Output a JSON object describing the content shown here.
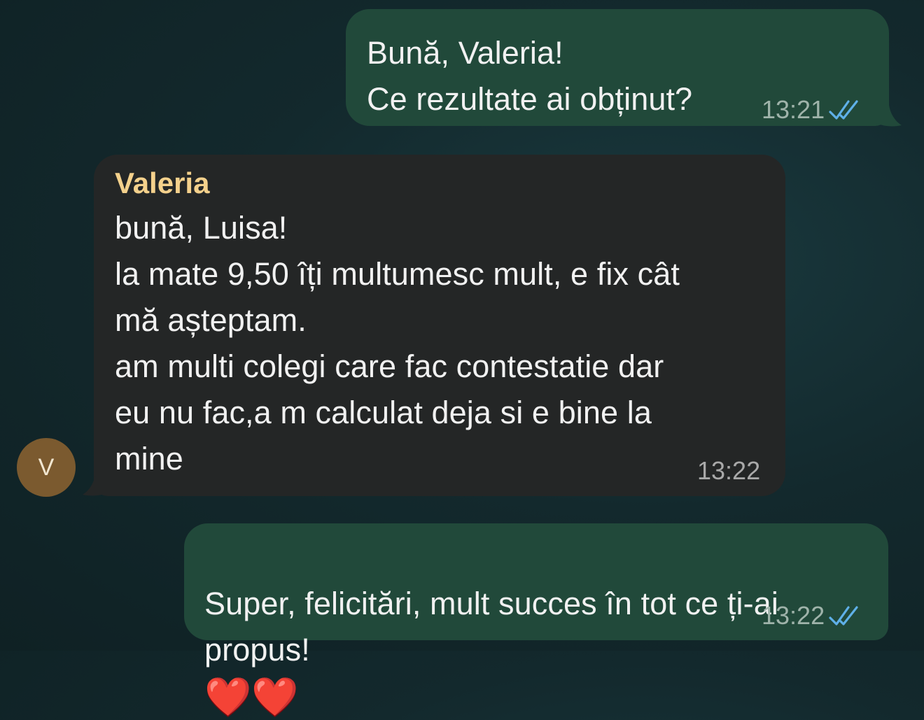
{
  "messages": [
    {
      "direction": "out",
      "text": "Bună, Valeria!\nCe rezultate ai obținut?",
      "time": "13:21",
      "status_icon": "double-check-read-icon"
    },
    {
      "direction": "in",
      "sender": "Valeria",
      "text": "bună, Luisa!\nla mate 9,50 îți multumesc mult, e fix cât\nmă așteptam.\nam multi colegi care fac contestatie dar\neu nu fac,a m calculat deja si e bine la\nmine",
      "time": "13:22"
    },
    {
      "direction": "out",
      "text": "Super, felicitări, mult succes în tot ce ți-ai\npropus!",
      "emoji": "❤️❤️",
      "time": "13:22",
      "status_icon": "double-check-read-icon"
    }
  ],
  "avatar": {
    "initial": "V"
  },
  "colors": {
    "outgoing_bubble": "#21493a",
    "incoming_bubble": "#242626",
    "sender_name": "#f4d18c",
    "read_ticks": "#5fb0e8",
    "avatar_bg": "#7b5a2f"
  }
}
